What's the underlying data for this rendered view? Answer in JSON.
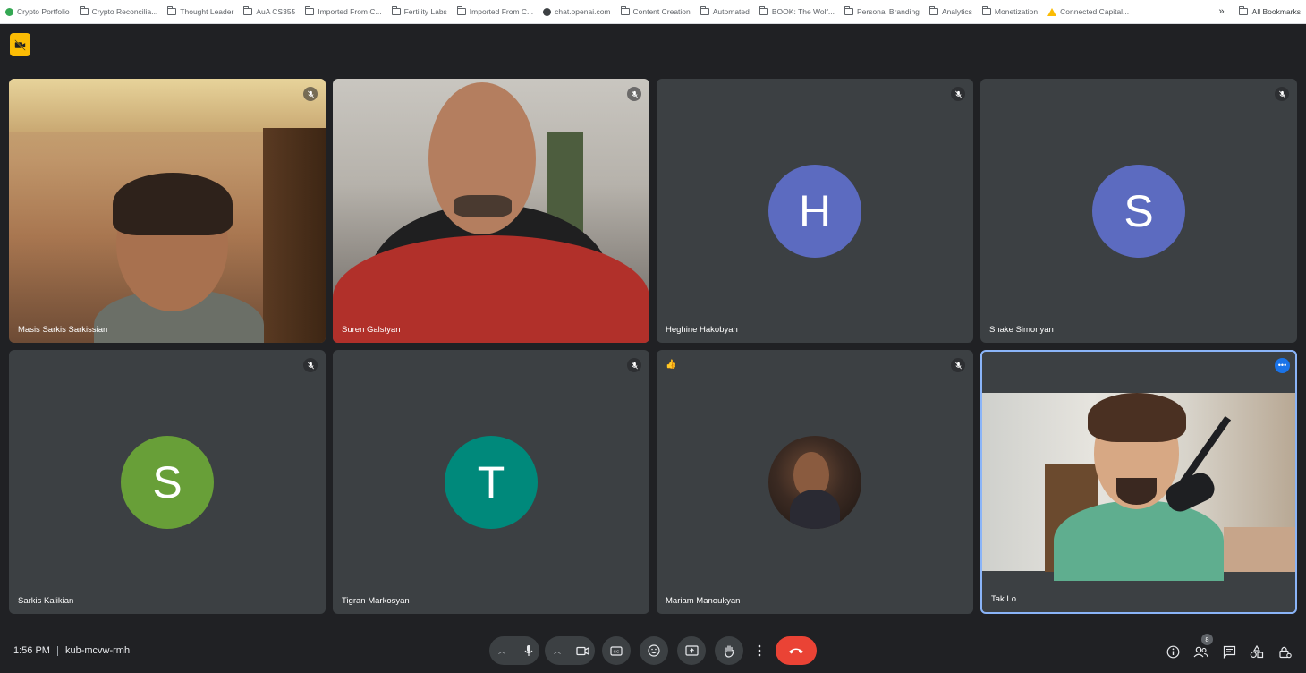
{
  "bookmarks": {
    "items": [
      {
        "label": "Crypto Portfolio",
        "icon": "green-dot-icon"
      },
      {
        "label": "Crypto Reconcilia...",
        "icon": "folder-icon"
      },
      {
        "label": "Thought Leader",
        "icon": "folder-icon"
      },
      {
        "label": "AuA CS355",
        "icon": "folder-icon"
      },
      {
        "label": "Imported From C...",
        "icon": "folder-icon"
      },
      {
        "label": "Fertility Labs",
        "icon": "folder-icon"
      },
      {
        "label": "Imported From C...",
        "icon": "folder-icon"
      },
      {
        "label": "chat.openai.com",
        "icon": "openai-icon"
      },
      {
        "label": "Content Creation",
        "icon": "folder-icon"
      },
      {
        "label": "Automated",
        "icon": "folder-icon"
      },
      {
        "label": "BOOK: The Wolf...",
        "icon": "folder-icon"
      },
      {
        "label": "Personal Branding",
        "icon": "folder-icon"
      },
      {
        "label": "Analytics",
        "icon": "folder-icon"
      },
      {
        "label": "Monetization",
        "icon": "folder-icon"
      },
      {
        "label": "Connected Capital...",
        "icon": "drive-icon"
      }
    ],
    "more": "»",
    "all": "All Bookmarks"
  },
  "tiles": [
    {
      "name": "Masis Sarkis Sarkissian",
      "type": "video"
    },
    {
      "name": "Suren Galstyan",
      "type": "video"
    },
    {
      "name": "Heghine Hakobyan",
      "type": "avatar",
      "initial": "H",
      "color": "#5c6bc0"
    },
    {
      "name": "Shake Simonyan",
      "type": "avatar",
      "initial": "S",
      "color": "#5c6bc0"
    },
    {
      "name": "Sarkis Kalikian",
      "type": "avatar",
      "initial": "S",
      "color": "#689f38"
    },
    {
      "name": "Tigran Markosyan",
      "type": "avatar",
      "initial": "T",
      "color": "#00897b"
    },
    {
      "name": "Mariam Manoukyan",
      "type": "photo-avatar",
      "reaction": "👍"
    },
    {
      "name": "Tak Lo",
      "type": "video",
      "more": "•••"
    }
  ],
  "footer": {
    "time": "1:56 PM",
    "meeting_code": "kub-mcvw-rmh",
    "participant_count": "8"
  },
  "colors": {
    "background": "#202124",
    "tile": "#3c4043",
    "end_call": "#ea4335",
    "active_border": "#8ab4f8",
    "badge": "#fbbc04"
  }
}
